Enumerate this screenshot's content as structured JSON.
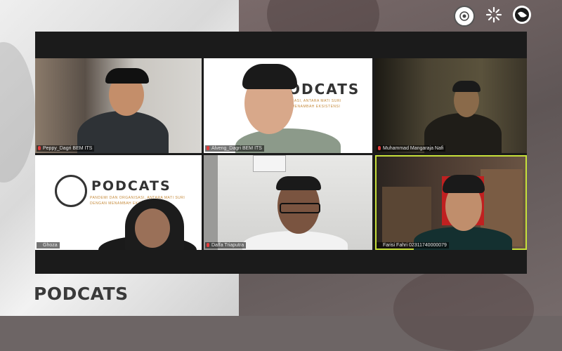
{
  "footer": {
    "title": "PODCATS"
  },
  "logos": [
    "university-seal-icon",
    "sun-burst-icon",
    "globe-icon"
  ],
  "colors": {
    "active_speaker": "#c7e03a",
    "muted_mic": "#e23c3c"
  },
  "participants": [
    {
      "name": "Peppy_Dagri BEM ITS",
      "muted": true
    },
    {
      "name": "Alveng_Dagri BEM ITS",
      "muted": true
    },
    {
      "name": "Muhammad Mangaraja Nafi",
      "muted": true
    },
    {
      "name": "Ghoza",
      "muted": false
    },
    {
      "name": "Daffa Triaputra",
      "muted": true
    },
    {
      "name": "Farisi Fahri 02311740000079",
      "muted": false,
      "active": true
    }
  ],
  "backdrop": {
    "title": "PODCATS",
    "subtitle_line1": "PANDEMI DAN ORGANISASI, ANTARA MATI SURI",
    "subtitle_line2": "DENGAN MENAMBAH EKSISTENSI",
    "tile2_title": "ODCATS",
    "tile2_sub1": "SASI, ANTARA MATI SURI",
    "tile2_sub2": "MENAMBAH EKSISTENSI"
  }
}
